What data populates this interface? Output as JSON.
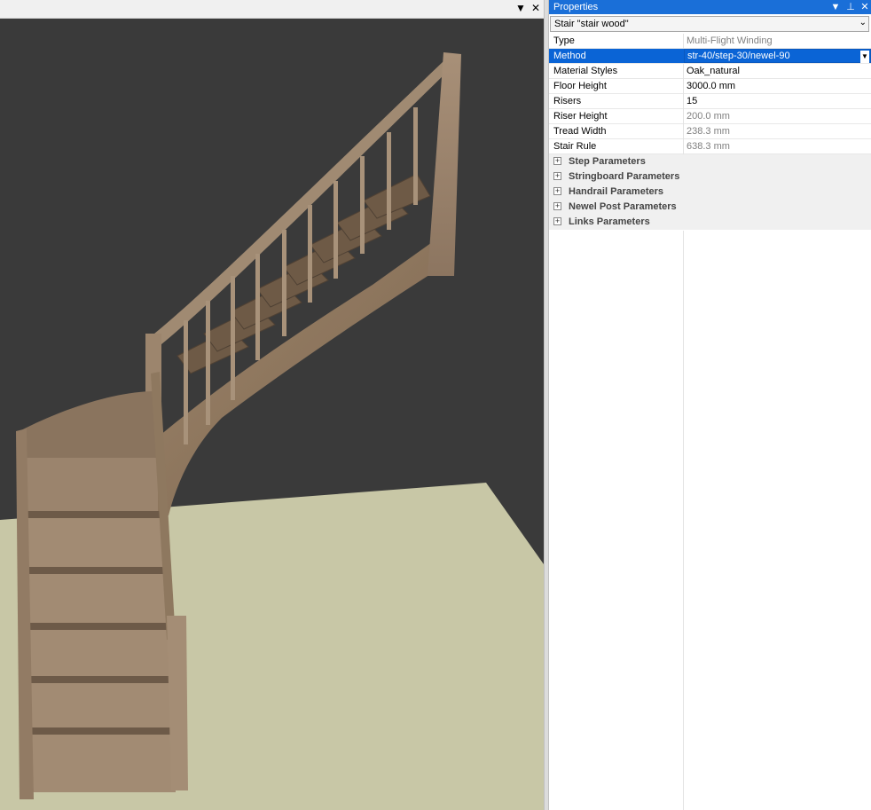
{
  "viewport": {
    "toolbar": {
      "dropdown_icon": "triangle-down",
      "close_icon": "close-x"
    }
  },
  "properties": {
    "title": "Properties",
    "object_selector": "Stair \"stair wood\"",
    "rows": [
      {
        "key": "Type",
        "value": "Multi-Flight Winding",
        "readonly": true
      },
      {
        "key": "Method",
        "value": "str-40/step-30/newel-90",
        "selected": true
      },
      {
        "key": "Material Styles",
        "value": "Oak_natural"
      },
      {
        "key": "Floor Height",
        "value": "3000.0 mm"
      },
      {
        "key": "Risers",
        "value": "15"
      },
      {
        "key": "Riser Height",
        "value": "200.0 mm",
        "readonly": true
      },
      {
        "key": "Tread Width",
        "value": "238.3 mm",
        "readonly": true
      },
      {
        "key": "Stair Rule",
        "value": "638.3 mm",
        "readonly": true
      }
    ],
    "groups": [
      "Step Parameters",
      "Stringboard Parameters",
      "Handrail Parameters",
      "Newel Post Parameters",
      "Links Parameters"
    ],
    "colors": {
      "title_bar": "#1a6fd8",
      "selected_row": "#0a64d6"
    }
  }
}
